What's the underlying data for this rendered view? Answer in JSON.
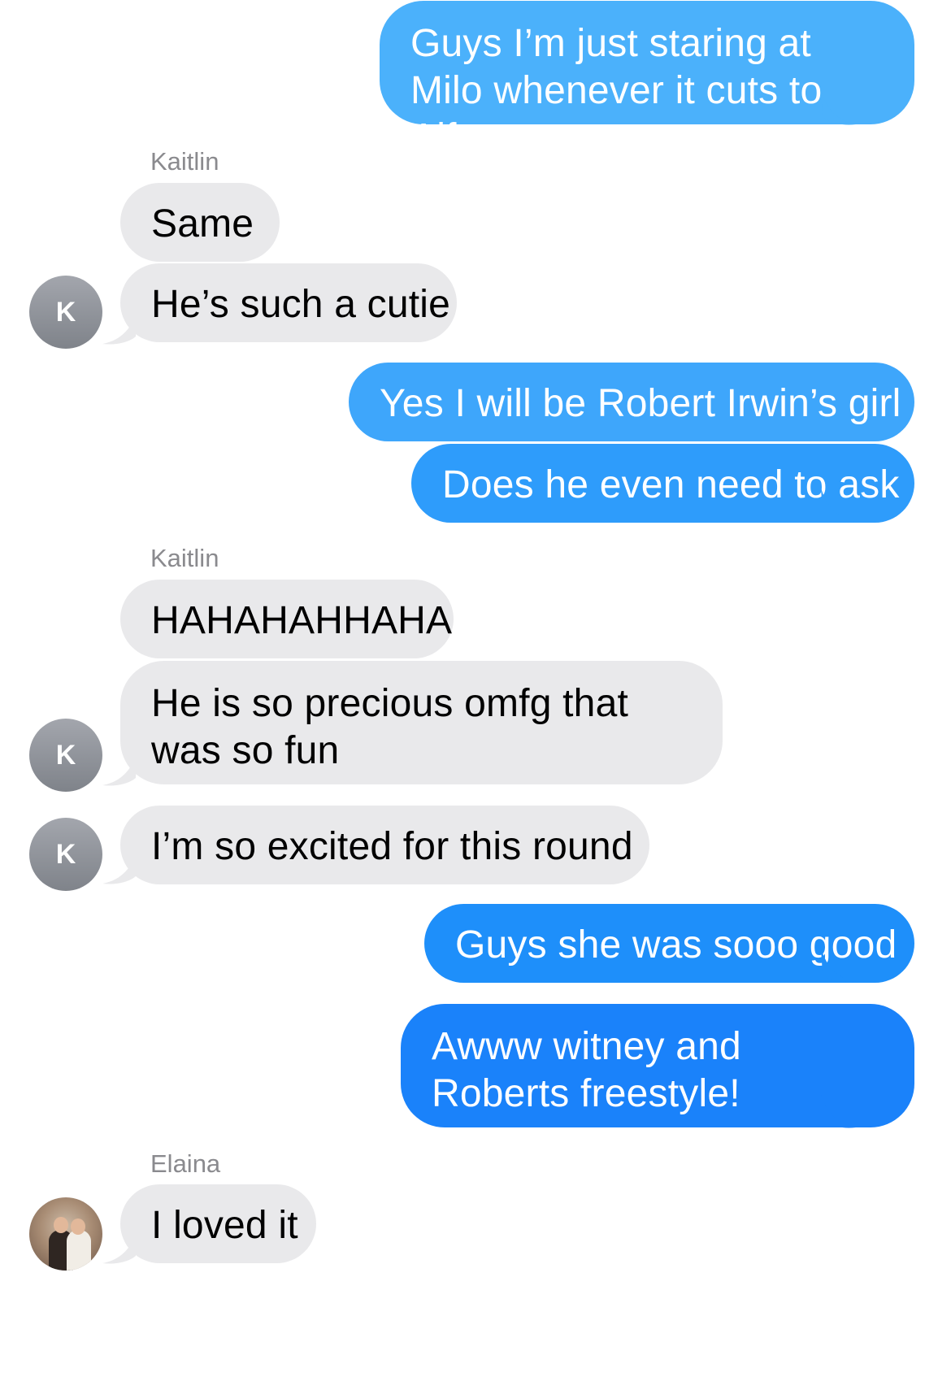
{
  "colors": {
    "incoming_bubble": "#e9e9eb",
    "outgoing_bubble_top": "#4cb2fb",
    "outgoing_bubble_bottom": "#1a80fa",
    "sender_name": "#8a8a8e",
    "avatar_gray": "#8e9197"
  },
  "messages": [
    {
      "direction": "outgoing",
      "text": "Guys I’m just staring at Milo whenever it cuts to Alfonso"
    },
    {
      "direction": "incoming",
      "sender": "Kaitlin",
      "text": "Same"
    },
    {
      "direction": "incoming",
      "avatar_initial": "K",
      "text": "He’s such a cutie"
    },
    {
      "direction": "outgoing",
      "text": "Yes I will be Robert Irwin’s girl"
    },
    {
      "direction": "outgoing",
      "text": "Does he even need to ask"
    },
    {
      "direction": "incoming",
      "sender": "Kaitlin",
      "text": "HAHAHAHHAHA"
    },
    {
      "direction": "incoming",
      "avatar_initial": "K",
      "text": "He is so precious omfg that was so fun"
    },
    {
      "direction": "incoming",
      "avatar_initial": "K",
      "text": "I’m so excited for this round"
    },
    {
      "direction": "outgoing",
      "text": "Guys she was sooo good"
    },
    {
      "direction": "outgoing",
      "text": "Awww witney and Roberts freestyle!"
    },
    {
      "direction": "incoming",
      "sender": "Elaina",
      "avatar_icon": "photo-avatar-icon",
      "text": "I loved it"
    }
  ]
}
